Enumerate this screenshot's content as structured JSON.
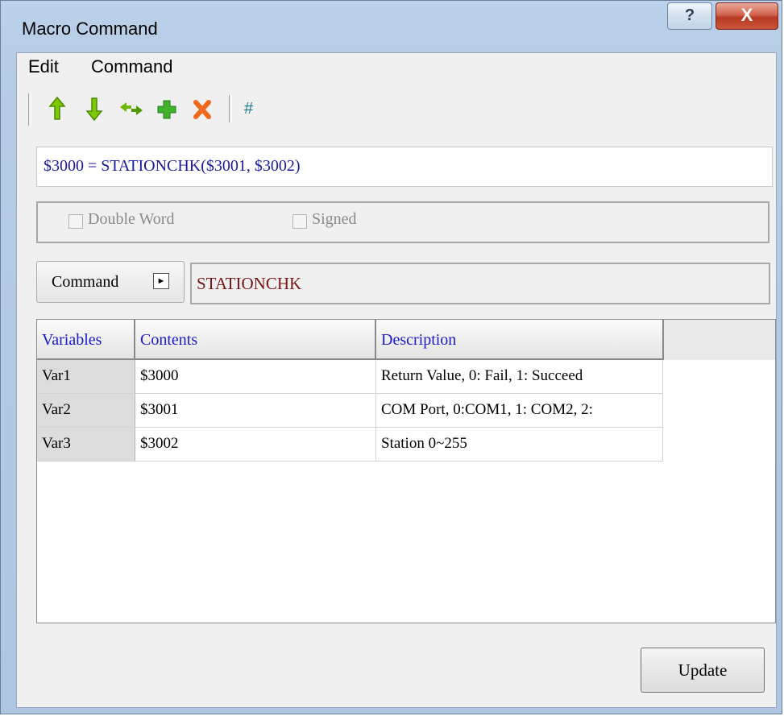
{
  "window": {
    "title": "Macro Command",
    "help_label": "?",
    "close_label": "X"
  },
  "menu": {
    "items": [
      {
        "label": "Edit"
      },
      {
        "label": "Command"
      }
    ]
  },
  "toolbar": {
    "move_up_icon": "arrow-up-icon",
    "move_down_icon": "arrow-down-icon",
    "swap_icon": "swap-icon",
    "add_icon": "plus-icon",
    "delete_icon": "delete-icon",
    "hash_label": "#"
  },
  "expression": {
    "value": "$3000 = STATIONCHK($3001, $3002)"
  },
  "options": {
    "double_word_label": "Double Word",
    "signed_label": "Signed"
  },
  "command": {
    "button_label": "Command",
    "name": "STATIONCHK"
  },
  "table": {
    "headers": [
      "Variables",
      "Contents",
      "Description"
    ],
    "rows": [
      {
        "var": "Var1",
        "contents": "$3000",
        "description": "Return Value, 0: Fail, 1: Succeed"
      },
      {
        "var": "Var2",
        "contents": "$3001",
        "description": "COM Port, 0:COM1, 1: COM2, 2:"
      },
      {
        "var": "Var3",
        "contents": "$3002",
        "description": "Station 0~255"
      }
    ]
  },
  "footer": {
    "update_label": "Update"
  },
  "colors": {
    "title_bg": "#b7cde6",
    "accent_blue": "#1a1ad0",
    "command_red": "#7b1515",
    "close_red": "#c9543a"
  }
}
